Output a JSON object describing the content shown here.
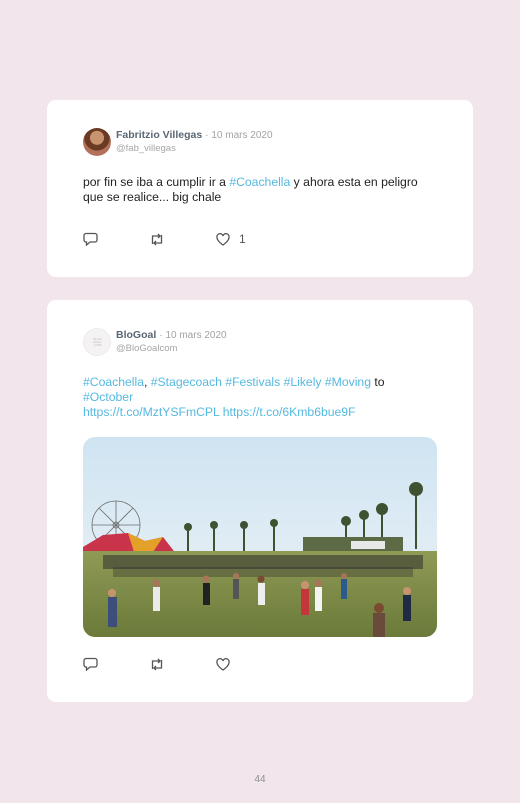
{
  "tweets": [
    {
      "name": "Fabritzio Villegas",
      "separator": "·",
      "date": "10 mars 2020",
      "handle": "@fab_villegas",
      "text_parts": [
        "por fin se iba a cumplir ir a ",
        "#Coachella",
        " y ahora esta en peligro que se realice... big chale"
      ],
      "like_count": "1"
    },
    {
      "name": "BloGoal",
      "separator": "·",
      "date": "10 mars 2020",
      "handle": "@BloGoalcom",
      "avatar_text": "BLOG GOAL .COM",
      "text_parts": [
        "#Coachella",
        ", ",
        "#Stagecoach",
        " ",
        "#Festivals",
        " ",
        "#Likely",
        " ",
        "#Moving",
        " to ",
        "#October",
        "https://t.co/MztYSFmCPL",
        " ",
        "https://t.co/6Kmb6bue9F"
      ],
      "like_count": ""
    }
  ],
  "icons": {
    "reply": "reply-icon",
    "retweet": "retweet-icon",
    "like": "heart-icon"
  },
  "colors": {
    "background": "#f2e6ec",
    "card": "#ffffff",
    "link": "#54b9e0"
  },
  "page_number": "44"
}
